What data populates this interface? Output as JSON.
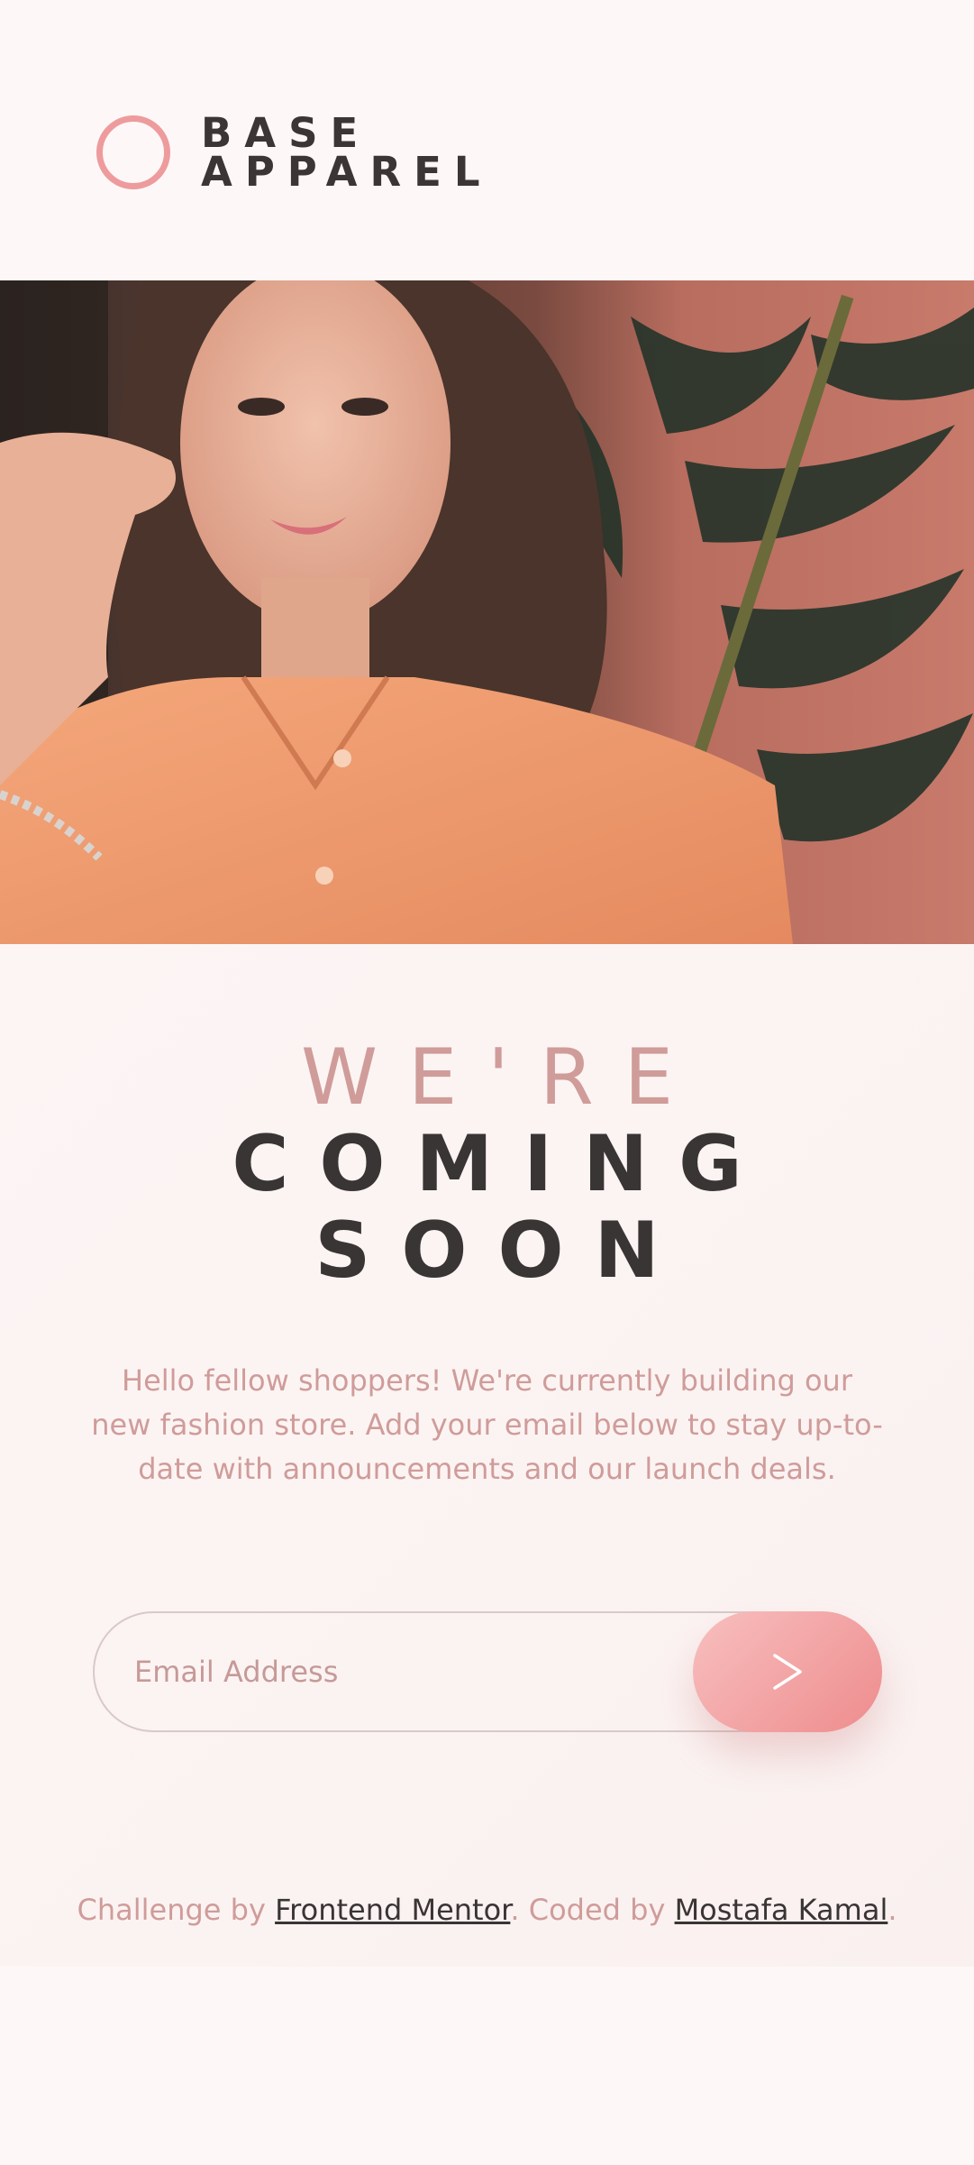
{
  "brand": {
    "line1": "BASE",
    "line2": "APPAREL",
    "accent": "#ee9b9d",
    "text_color": "#3b3535"
  },
  "hero": {
    "icon": "hero-photo"
  },
  "headline": {
    "light": "WE'RE",
    "bold_line1": "COMING",
    "bold_line2": "SOON"
  },
  "intro": "Hello fellow shoppers! We're currently building our new fashion store. Add your email below to stay up-to-date with announcements and our launch deals.",
  "form": {
    "email_placeholder": "Email Address",
    "submit_icon": "arrow-right-icon",
    "button_gradient": [
      "#f8bfbf",
      "#ee8c8d"
    ]
  },
  "footer": {
    "prefix": "Challenge by ",
    "link1": "Frontend Mentor",
    "middle": ". Coded by ",
    "link2": "Mostafa Kamal",
    "suffix": "."
  },
  "colors": {
    "background": "#fdf8f7",
    "muted_pink": "#cf9c9a",
    "dark": "#3a3535"
  }
}
